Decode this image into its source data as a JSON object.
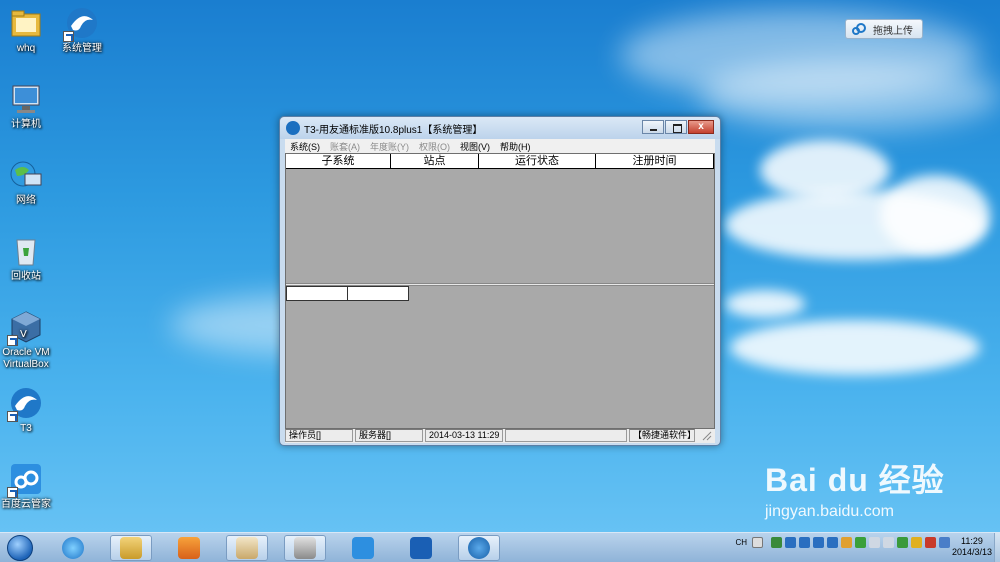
{
  "desktop": {
    "icons": [
      {
        "label": "whq"
      },
      {
        "label": "系统管理"
      },
      {
        "label": "计算机"
      },
      {
        "label": "网络"
      },
      {
        "label": "回收站"
      },
      {
        "label": "Oracle VM VirtualBox"
      },
      {
        "label": "T3"
      },
      {
        "label": "百度云管家"
      }
    ],
    "upload_button": "拖拽上传"
  },
  "window": {
    "title": "T3-用友通标准版10.8plus1【系统管理】",
    "close_glyph": "x",
    "menu": [
      {
        "label": "系统(S)",
        "enabled": true
      },
      {
        "label": "账套(A)",
        "enabled": false
      },
      {
        "label": "年度账(Y)",
        "enabled": false
      },
      {
        "label": "权限(O)",
        "enabled": false
      },
      {
        "label": "视图(V)",
        "enabled": true
      },
      {
        "label": "帮助(H)",
        "enabled": true
      }
    ],
    "grid_columns": [
      "子系统",
      "站点",
      "运行状态",
      "注册时间"
    ],
    "status": {
      "operator": "操作员[]",
      "server": "服务器[]",
      "datetime": "2014-03-13 11:29",
      "vendor": "【畅捷通软件】"
    }
  },
  "taskbar": {
    "tray_lang": "CH",
    "clock_time": "11:29",
    "clock_date": "2014/3/13"
  },
  "watermark": {
    "brand": "Bai du 经验",
    "url": "jingyan.baidu.com"
  },
  "colors": {
    "desktop_blue": "#2d9ae0",
    "client_gray": "#a9a9a9",
    "window_frame": "#c9dcef"
  }
}
